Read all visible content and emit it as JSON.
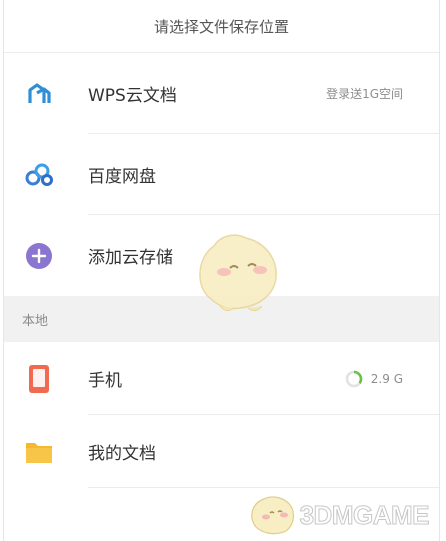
{
  "header": {
    "title": "请选择文件保存位置"
  },
  "cloud": {
    "items": [
      {
        "label": "WPS云文档",
        "meta": "登录送1G空间",
        "icon": "wps-cloud-icon",
        "color": "#2f8fd6"
      },
      {
        "label": "百度网盘",
        "meta": "",
        "icon": "baidu-netdisk-icon",
        "color": "#3a7fd6"
      },
      {
        "label": "添加云存储",
        "meta": "",
        "icon": "add-cloud-icon",
        "color": "#8a76d0"
      }
    ]
  },
  "section": {
    "label": "本地"
  },
  "local": {
    "items": [
      {
        "label": "手机",
        "meta": "2.9 G",
        "icon": "phone-icon",
        "color": "#f06a4f",
        "usage_fraction": 0.35
      },
      {
        "label": "我的文档",
        "meta": "",
        "icon": "folder-icon",
        "color": "#f5b82e"
      }
    ]
  },
  "watermark": {
    "text": "3DMGAME"
  }
}
